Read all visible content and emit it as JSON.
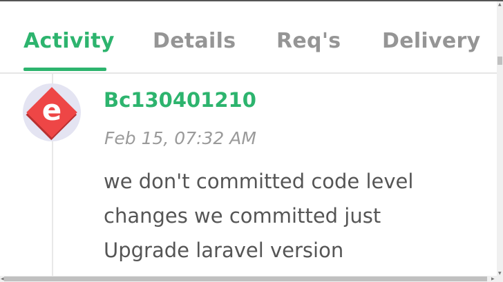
{
  "tabs": [
    {
      "label": "Activity",
      "active": true
    },
    {
      "label": "Details",
      "active": false
    },
    {
      "label": "Req's",
      "active": false
    },
    {
      "label": "Delivery",
      "active": false
    }
  ],
  "activity": {
    "avatar_letter": "e",
    "username": "Bc130401210",
    "timestamp": "Feb 15, 07:32 AM",
    "message": "we don't committed code level changes we committed just Upgrade laravel version"
  },
  "colors": {
    "accent": "#2db46e",
    "avatar": "#ee4646"
  }
}
